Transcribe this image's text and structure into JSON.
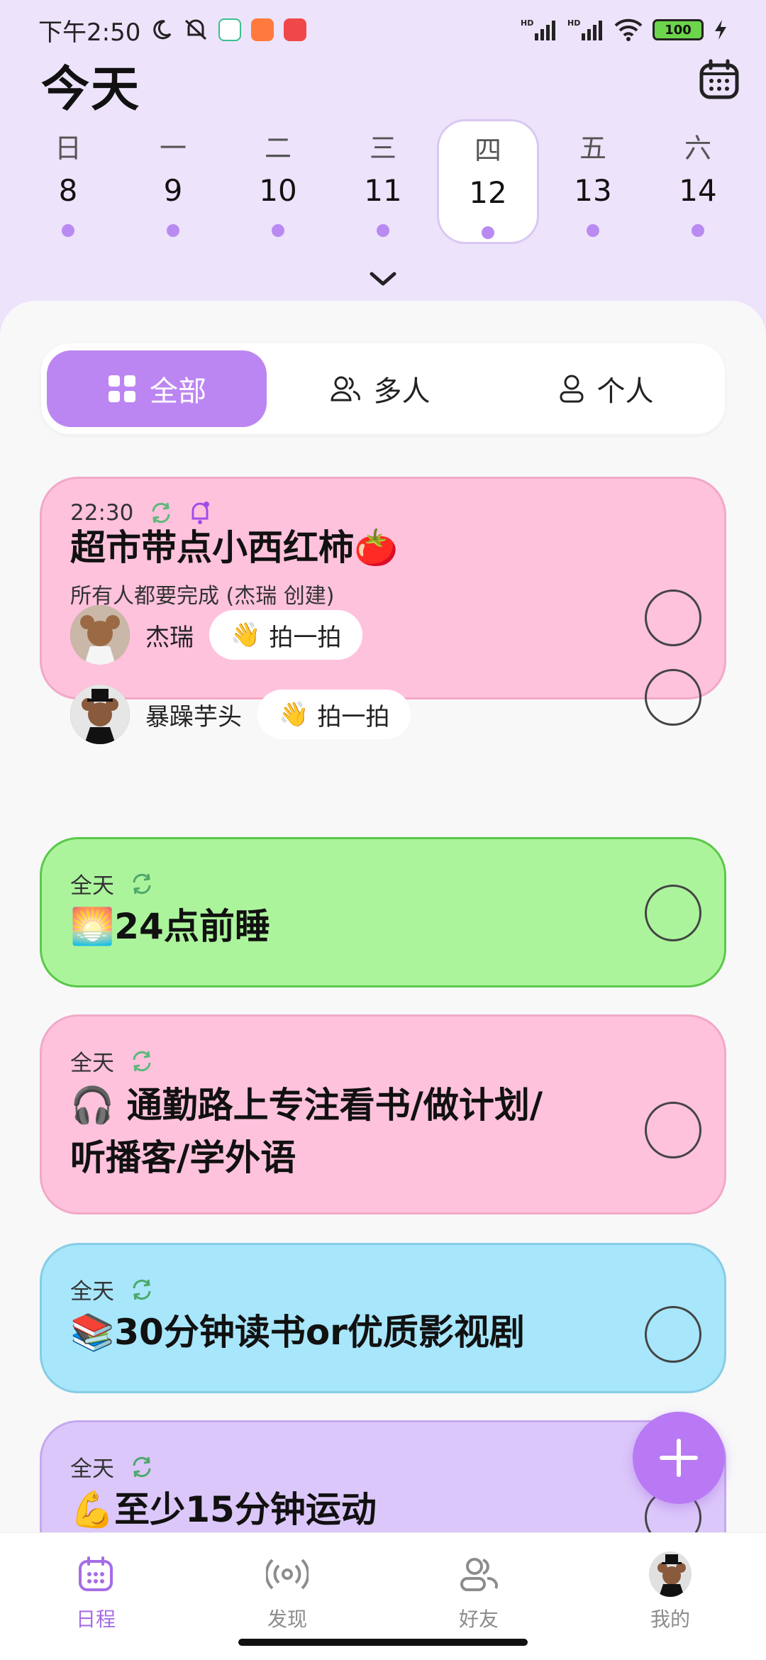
{
  "status_bar": {
    "time": "下午2:50",
    "battery": "100",
    "network_1": "HD",
    "network_2": "HD"
  },
  "header": {
    "title": "今天"
  },
  "week": [
    {
      "weekday": "日",
      "date": "8"
    },
    {
      "weekday": "一",
      "date": "9"
    },
    {
      "weekday": "二",
      "date": "10"
    },
    {
      "weekday": "三",
      "date": "11"
    },
    {
      "weekday": "四",
      "date": "12",
      "selected": true
    },
    {
      "weekday": "五",
      "date": "13"
    },
    {
      "weekday": "六",
      "date": "14"
    }
  ],
  "filter": {
    "all": "全部",
    "group": "多人",
    "personal": "个人",
    "active": "all"
  },
  "tasks": [
    {
      "time": "22:30",
      "title": "超市带点小西红柿🍅",
      "subtitle": "所有人都要完成 (杰瑞 创建)",
      "color": "#FFC2DC",
      "members": [
        {
          "name": "杰瑞",
          "action": "拍一拍"
        },
        {
          "name": "暴躁芋头",
          "action": "拍一拍"
        }
      ]
    },
    {
      "time": "全天",
      "title": "🌅24点前睡",
      "color": "#ACF49C"
    },
    {
      "time": "全天",
      "title_line1": "🎧 通勤路上专注看书/做计划/",
      "title_line2": "听播客/学外语",
      "color": "#FFC2DC"
    },
    {
      "time": "全天",
      "title": "📚30分钟读书or优质影视剧",
      "color": "#A7E6FB"
    },
    {
      "time": "全天",
      "title": "💪至少15分钟运动",
      "color": "#DCC7FA"
    }
  ],
  "bottom_nav": [
    {
      "label": "日程",
      "icon": "calendar-icon",
      "active": true
    },
    {
      "label": "发现",
      "icon": "broadcast-icon"
    },
    {
      "label": "好友",
      "icon": "friends-icon"
    },
    {
      "label": "我的",
      "icon": "avatar"
    }
  ],
  "colors": {
    "accent": "#BC86F2",
    "background": "#EDE3FB"
  }
}
